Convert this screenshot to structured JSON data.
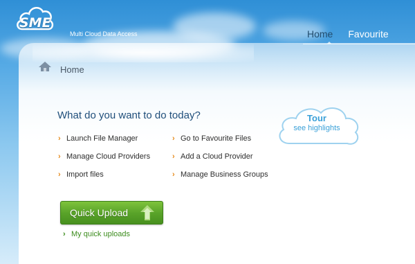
{
  "brand": {
    "logo_text": "SME",
    "tagline": "Multi Cloud Data Access"
  },
  "nav": {
    "items": [
      {
        "label": "Home",
        "active": true
      },
      {
        "label": "Favourite",
        "active": false
      }
    ]
  },
  "breadcrumb": {
    "icon": "home-icon",
    "label": "Home"
  },
  "main": {
    "heading": "What do you want to do today?",
    "actions": [
      {
        "label": "Launch File Manager"
      },
      {
        "label": "Manage Cloud Providers"
      },
      {
        "label": "Import files"
      },
      {
        "label": "Go to Favourite Files"
      },
      {
        "label": "Add a Cloud Provider"
      },
      {
        "label": "Manage Business Groups"
      }
    ],
    "quick_upload": {
      "label": "Quick Upload",
      "icon": "upload-arrow-icon"
    },
    "my_uploads": "My quick uploads"
  },
  "tour": {
    "title": "Tour",
    "subtitle": "see highlights"
  },
  "colors": {
    "accent_orange": "#e68a1b",
    "heading_blue": "#1f4e7a",
    "upload_green": "#5aa42a",
    "tour_blue": "#3aa0d8"
  }
}
